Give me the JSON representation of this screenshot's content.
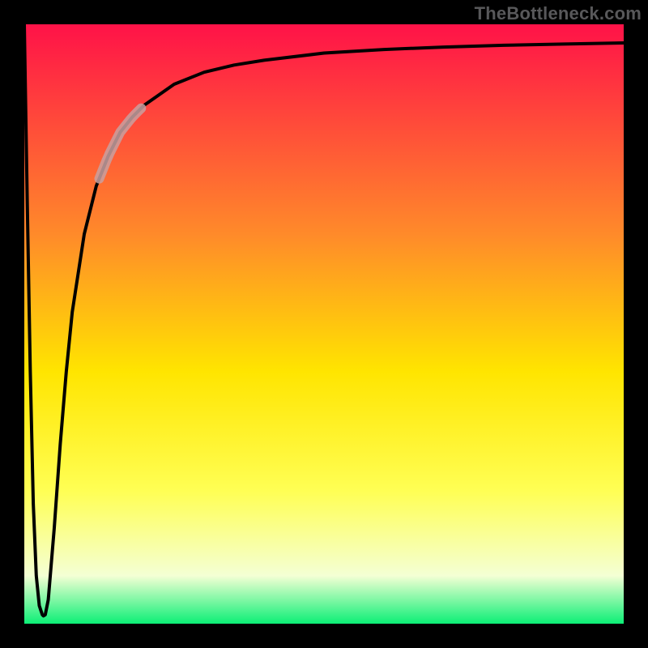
{
  "watermark": "TheBottleneck.com",
  "colors": {
    "frame": "#000000",
    "curve": "#000000",
    "highlight": "#c9a0a0",
    "grad_top": "#ff1248",
    "grad_mid1": "#ff8a2a",
    "grad_mid2": "#ffe500",
    "grad_mid3": "#ffff55",
    "grad_mid4": "#f4ffd4",
    "grad_bottom": "#0cef76"
  },
  "chart_data": {
    "type": "line",
    "title": "",
    "xlabel": "",
    "ylabel": "",
    "xlim": [
      0,
      100
    ],
    "ylim": [
      0,
      100
    ],
    "curve": {
      "x": [
        0,
        0.5,
        1.0,
        1.5,
        2.0,
        2.5,
        3.0,
        3.2,
        3.5,
        4.0,
        5.0,
        6.0,
        7.0,
        8.0,
        10.0,
        12.0,
        14.0,
        16.0,
        18.0,
        20.0,
        25.0,
        30.0,
        35.0,
        40.0,
        50.0,
        60.0,
        70.0,
        80.0,
        90.0,
        100.0
      ],
      "y": [
        100,
        70,
        42,
        20,
        8,
        3,
        1.5,
        1.3,
        1.5,
        4,
        16,
        30,
        42,
        52,
        65,
        73,
        78,
        82,
        84.5,
        86.5,
        90,
        92,
        93.2,
        94,
        95.2,
        95.8,
        96.2,
        96.5,
        96.7,
        96.9
      ]
    },
    "highlight_range": {
      "x_start": 12.5,
      "x_end": 19.5
    },
    "annotations": []
  }
}
